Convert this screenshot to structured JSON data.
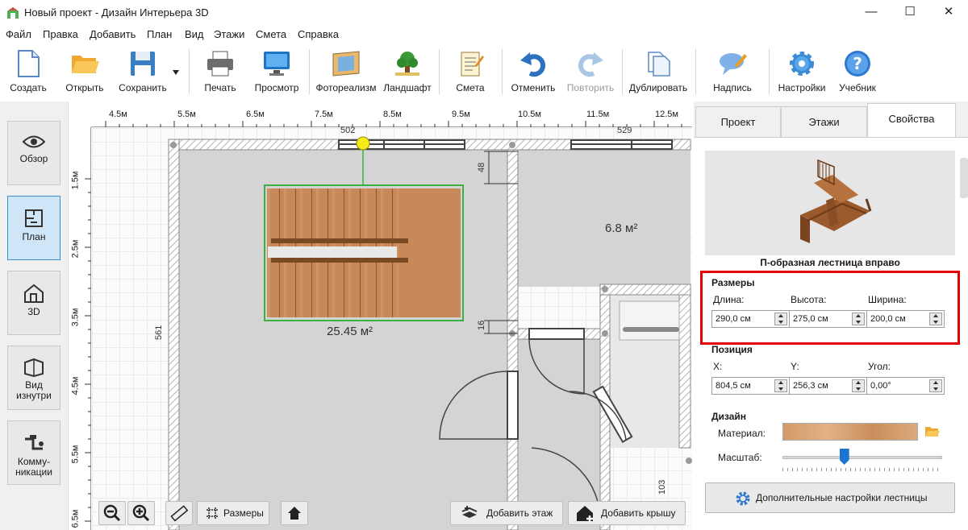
{
  "window": {
    "title": "Новый проект - Дизайн Интерьера 3D",
    "minimize": "—",
    "maximize": "☐",
    "close": "✕"
  },
  "menu": [
    "Файл",
    "Правка",
    "Добавить",
    "План",
    "Вид",
    "Этажи",
    "Смета",
    "Справка"
  ],
  "toolbar": {
    "create": "Создать",
    "open": "Открыть",
    "save": "Сохранить",
    "print": "Печать",
    "preview": "Просмотр",
    "photorealism": "Фотореализм",
    "landscape": "Ландшафт",
    "estimate": "Смета",
    "undo": "Отменить",
    "redo": "Повторить",
    "duplicate": "Дублировать",
    "label": "Надпись",
    "settings": "Настройки",
    "tutorial": "Учебник"
  },
  "modes": {
    "overview": "Обзор",
    "plan": "План",
    "view3d": "3D",
    "inside": "Вид изнутри",
    "utilities": "Комму- никации"
  },
  "plan": {
    "ruler_top": [
      "4.5м",
      "5.5м",
      "6.5м",
      "7.5м",
      "8.5м",
      "9.5м",
      "10.5м",
      "11.5м",
      "12.5м"
    ],
    "ruler_left": [
      "1.5м",
      "2.5м",
      "3.5м",
      "4.5м",
      "5.5м",
      "6.5м"
    ],
    "dim_top_1": "502",
    "dim_top_2": "529",
    "dim_48": "48",
    "dim_16": "16",
    "dim_561": "561",
    "dim_103": "103",
    "area_main": "25.45 м²",
    "area_right": "6.8 м²",
    "btn_dimensions": "Размеры",
    "btn_add_floor": "Добавить этаж",
    "btn_add_roof": "Добавить крышу"
  },
  "tabs": [
    "Проект",
    "Этажи",
    "Свойства"
  ],
  "properties": {
    "stair_name": "П-образная лестница вправо",
    "sizes_title": "Размеры",
    "length_label": "Длина:",
    "length_value": "290,0 см",
    "height_label": "Высота:",
    "height_value": "275,0 см",
    "width_label": "Ширина:",
    "width_value": "200,0 см",
    "position_title": "Позиция",
    "x_label": "X:",
    "x_value": "804,5 см",
    "y_label": "Y:",
    "y_value": "256,3 см",
    "angle_label": "Угол:",
    "angle_value": "0,00°",
    "design_title": "Дизайн",
    "material_label": "Материал:",
    "scale_label": "Масштаб:",
    "scale_level": 0.38,
    "advanced_button": "Дополнительные настройки лестницы"
  },
  "colors": {
    "accent": "#3c8fd0",
    "highlight": "#e30000",
    "wood": "#c8895a",
    "selection": "#3cb043"
  }
}
